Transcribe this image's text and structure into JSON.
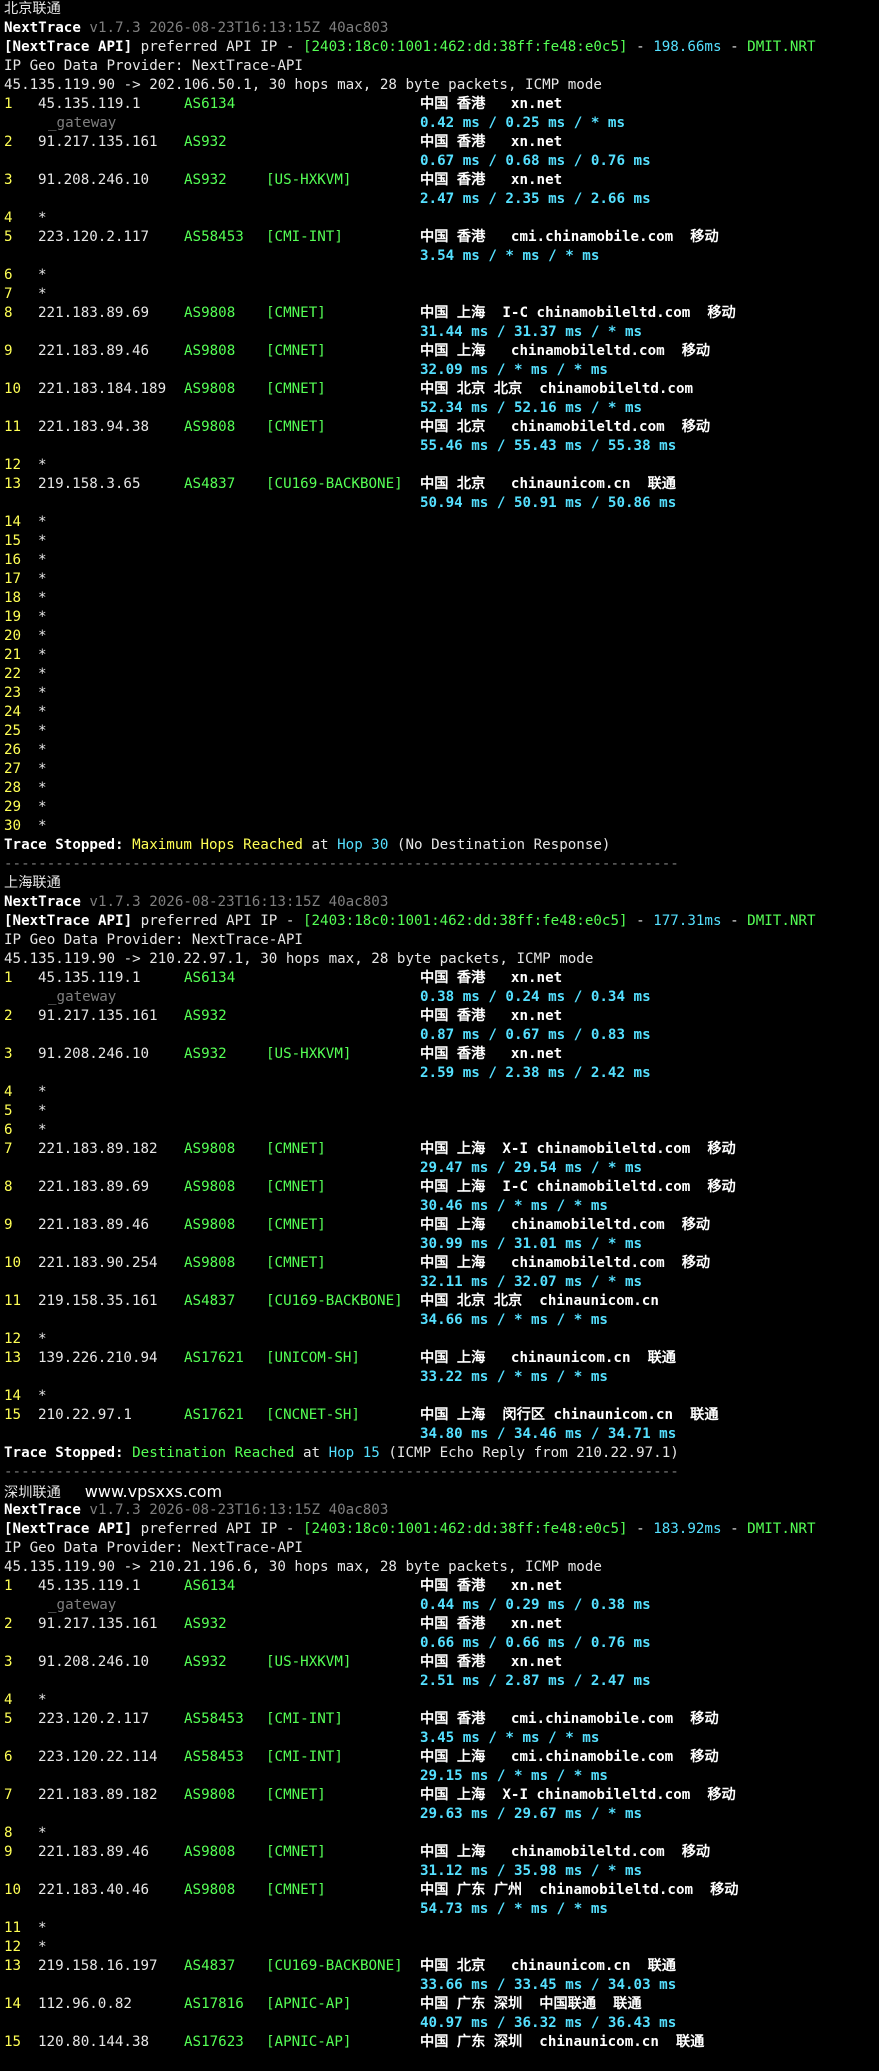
{
  "sections": [
    {
      "title": "北京联通",
      "tool": "NextTrace",
      "version": "v1.7.3 2026-08-23T16:13:15Z 40ac803",
      "api_line": {
        "tag": "[NextTrace API]",
        "text": " preferred API IP - ",
        "ip": "[2403:18c0:1001:462:dd:38ff:fe48:e0c5]",
        "sep": " - ",
        "rtt": "198.66ms",
        "sep2": " - ",
        "node": "DMIT.NRT"
      },
      "provider": "IP Geo Data Provider: NextTrace-API",
      "route": "45.135.119.90 -> 202.106.50.1, 30 hops max, 28 byte packets, ICMP mode",
      "hops": [
        {
          "n": "1",
          "ip": "45.135.119.1",
          "as": "AS6134",
          "tag": "",
          "geo": "中国 香港   xn.net",
          "gw": "_gateway",
          "rtt": "0.42 ms / 0.25 ms / * ms"
        },
        {
          "n": "2",
          "ip": "91.217.135.161",
          "as": "AS932",
          "tag": "",
          "geo": "中国 香港   xn.net",
          "rtt": "0.67 ms / 0.68 ms / 0.76 ms"
        },
        {
          "n": "3",
          "ip": "91.208.246.10",
          "as": "AS932",
          "tag": "[US-HXKVM]",
          "geo": "中国 香港   xn.net",
          "rtt": "2.47 ms / 2.35 ms / 2.66 ms"
        },
        {
          "n": "4",
          "ip": "*"
        },
        {
          "n": "5",
          "ip": "223.120.2.117",
          "as": "AS58453",
          "tag": "[CMI-INT]",
          "geo": "中国 香港   cmi.chinamobile.com  移动",
          "rtt": "3.54 ms / * ms / * ms"
        },
        {
          "n": "6",
          "ip": "*"
        },
        {
          "n": "7",
          "ip": "*"
        },
        {
          "n": "8",
          "ip": "221.183.89.69",
          "as": "AS9808",
          "tag": "[CMNET]",
          "geo": "中国 上海  I-C chinamobileltd.com  移动",
          "rtt": "31.44 ms / 31.37 ms / * ms"
        },
        {
          "n": "9",
          "ip": "221.183.89.46",
          "as": "AS9808",
          "tag": "[CMNET]",
          "geo": "中国 上海   chinamobileltd.com  移动",
          "rtt": "32.09 ms / * ms / * ms"
        },
        {
          "n": "10",
          "ip": "221.183.184.189",
          "as": "AS9808",
          "tag": "[CMNET]",
          "geo": "中国 北京 北京  chinamobileltd.com",
          "rtt": "52.34 ms / 52.16 ms / * ms"
        },
        {
          "n": "11",
          "ip": "221.183.94.38",
          "as": "AS9808",
          "tag": "[CMNET]",
          "geo": "中国 北京   chinamobileltd.com  移动",
          "rtt": "55.46 ms / 55.43 ms / 55.38 ms"
        },
        {
          "n": "12",
          "ip": "*"
        },
        {
          "n": "13",
          "ip": "219.158.3.65",
          "as": "AS4837",
          "tag": "[CU169-BACKBONE]",
          "geo": "中国 北京   chinaunicom.cn  联通",
          "rtt": "50.94 ms / 50.91 ms / 50.86 ms"
        },
        {
          "n": "14",
          "ip": "*"
        },
        {
          "n": "15",
          "ip": "*"
        },
        {
          "n": "16",
          "ip": "*"
        },
        {
          "n": "17",
          "ip": "*"
        },
        {
          "n": "18",
          "ip": "*"
        },
        {
          "n": "19",
          "ip": "*"
        },
        {
          "n": "20",
          "ip": "*"
        },
        {
          "n": "21",
          "ip": "*"
        },
        {
          "n": "22",
          "ip": "*"
        },
        {
          "n": "23",
          "ip": "*"
        },
        {
          "n": "24",
          "ip": "*"
        },
        {
          "n": "25",
          "ip": "*"
        },
        {
          "n": "26",
          "ip": "*"
        },
        {
          "n": "27",
          "ip": "*"
        },
        {
          "n": "28",
          "ip": "*"
        },
        {
          "n": "29",
          "ip": "*"
        },
        {
          "n": "30",
          "ip": "*"
        }
      ],
      "stop": {
        "prefix": "Trace Stopped: ",
        "reason": "Maximum Hops Reached",
        "mid": " at ",
        "hop": "Hop 30",
        "suffix": " (No Destination Response)",
        "reason_color": "y"
      }
    },
    {
      "title": "上海联通",
      "tool": "NextTrace",
      "version": "v1.7.3 2026-08-23T16:13:15Z 40ac803",
      "api_line": {
        "tag": "[NextTrace API]",
        "text": " preferred API IP - ",
        "ip": "[2403:18c0:1001:462:dd:38ff:fe48:e0c5]",
        "sep": " - ",
        "rtt": "177.31ms",
        "sep2": " - ",
        "node": "DMIT.NRT"
      },
      "provider": "IP Geo Data Provider: NextTrace-API",
      "route": "45.135.119.90 -> 210.22.97.1, 30 hops max, 28 byte packets, ICMP mode",
      "hops": [
        {
          "n": "1",
          "ip": "45.135.119.1",
          "as": "AS6134",
          "tag": "",
          "geo": "中国 香港   xn.net",
          "gw": "_gateway",
          "rtt": "0.38 ms / 0.24 ms / 0.34 ms"
        },
        {
          "n": "2",
          "ip": "91.217.135.161",
          "as": "AS932",
          "tag": "",
          "geo": "中国 香港   xn.net",
          "rtt": "0.87 ms / 0.67 ms / 0.83 ms"
        },
        {
          "n": "3",
          "ip": "91.208.246.10",
          "as": "AS932",
          "tag": "[US-HXKVM]",
          "geo": "中国 香港   xn.net",
          "rtt": "2.59 ms / 2.38 ms / 2.42 ms"
        },
        {
          "n": "4",
          "ip": "*"
        },
        {
          "n": "5",
          "ip": "*"
        },
        {
          "n": "6",
          "ip": "*"
        },
        {
          "n": "7",
          "ip": "221.183.89.182",
          "as": "AS9808",
          "tag": "[CMNET]",
          "geo": "中国 上海  X-I chinamobileltd.com  移动",
          "rtt": "29.47 ms / 29.54 ms / * ms"
        },
        {
          "n": "8",
          "ip": "221.183.89.69",
          "as": "AS9808",
          "tag": "[CMNET]",
          "geo": "中国 上海  I-C chinamobileltd.com  移动",
          "rtt": "30.46 ms / * ms / * ms"
        },
        {
          "n": "9",
          "ip": "221.183.89.46",
          "as": "AS9808",
          "tag": "[CMNET]",
          "geo": "中国 上海   chinamobileltd.com  移动",
          "rtt": "30.99 ms / 31.01 ms / * ms"
        },
        {
          "n": "10",
          "ip": "221.183.90.254",
          "as": "AS9808",
          "tag": "[CMNET]",
          "geo": "中国 上海   chinamobileltd.com  移动",
          "rtt": "32.11 ms / 32.07 ms / * ms"
        },
        {
          "n": "11",
          "ip": "219.158.35.161",
          "as": "AS4837",
          "tag": "[CU169-BACKBONE]",
          "geo": "中国 北京 北京  chinaunicom.cn",
          "rtt": "34.66 ms / * ms / * ms"
        },
        {
          "n": "12",
          "ip": "*"
        },
        {
          "n": "13",
          "ip": "139.226.210.94",
          "as": "AS17621",
          "tag": "[UNICOM-SH]",
          "geo": "中国 上海   chinaunicom.cn  联通",
          "rtt": "33.22 ms / * ms / * ms"
        },
        {
          "n": "14",
          "ip": "*"
        },
        {
          "n": "15",
          "ip": "210.22.97.1",
          "as": "AS17621",
          "tag": "[CNCNET-SH]",
          "geo": "中国 上海  闵行区 chinaunicom.cn  联通",
          "rtt": "34.80 ms / 34.46 ms / 34.71 ms"
        }
      ],
      "stop": {
        "prefix": "Trace Stopped: ",
        "reason": "Destination Reached",
        "mid": " at ",
        "hop": "Hop 15",
        "suffix": " (ICMP Echo Reply from 210.22.97.1)",
        "reason_color": "gr"
      }
    },
    {
      "title": "深圳联通",
      "site": "www.vpsxxs.com",
      "tool": "NextTrace",
      "version": "v1.7.3 2026-08-23T16:13:15Z 40ac803",
      "api_line": {
        "tag": "[NextTrace API]",
        "text": " preferred API IP - ",
        "ip": "[2403:18c0:1001:462:dd:38ff:fe48:e0c5]",
        "sep": " - ",
        "rtt": "183.92ms",
        "sep2": " - ",
        "node": "DMIT.NRT"
      },
      "provider": "IP Geo Data Provider: NextTrace-API",
      "route": "45.135.119.90 -> 210.21.196.6, 30 hops max, 28 byte packets, ICMP mode",
      "hops": [
        {
          "n": "1",
          "ip": "45.135.119.1",
          "as": "AS6134",
          "tag": "",
          "geo": "中国 香港   xn.net",
          "gw": "_gateway",
          "rtt": "0.44 ms / 0.29 ms / 0.38 ms"
        },
        {
          "n": "2",
          "ip": "91.217.135.161",
          "as": "AS932",
          "tag": "",
          "geo": "中国 香港   xn.net",
          "rtt": "0.66 ms / 0.66 ms / 0.76 ms"
        },
        {
          "n": "3",
          "ip": "91.208.246.10",
          "as": "AS932",
          "tag": "[US-HXKVM]",
          "geo": "中国 香港   xn.net",
          "rtt": "2.51 ms / 2.87 ms / 2.47 ms"
        },
        {
          "n": "4",
          "ip": "*"
        },
        {
          "n": "5",
          "ip": "223.120.2.117",
          "as": "AS58453",
          "tag": "[CMI-INT]",
          "geo": "中国 香港   cmi.chinamobile.com  移动",
          "rtt": "3.45 ms / * ms / * ms"
        },
        {
          "n": "6",
          "ip": "223.120.22.114",
          "as": "AS58453",
          "tag": "[CMI-INT]",
          "geo": "中国 上海   cmi.chinamobile.com  移动",
          "rtt": "29.15 ms / * ms / * ms"
        },
        {
          "n": "7",
          "ip": "221.183.89.182",
          "as": "AS9808",
          "tag": "[CMNET]",
          "geo": "中国 上海  X-I chinamobileltd.com  移动",
          "rtt": "29.63 ms / 29.67 ms / * ms"
        },
        {
          "n": "8",
          "ip": "*"
        },
        {
          "n": "9",
          "ip": "221.183.89.46",
          "as": "AS9808",
          "tag": "[CMNET]",
          "geo": "中国 上海   chinamobileltd.com  移动",
          "rtt": "31.12 ms / 35.98 ms / * ms"
        },
        {
          "n": "10",
          "ip": "221.183.40.46",
          "as": "AS9808",
          "tag": "[CMNET]",
          "geo": "中国 广东 广州  chinamobileltd.com  移动",
          "rtt": "54.73 ms / * ms / * ms"
        },
        {
          "n": "11",
          "ip": "*"
        },
        {
          "n": "12",
          "ip": "*"
        },
        {
          "n": "13",
          "ip": "219.158.16.197",
          "as": "AS4837",
          "tag": "[CU169-BACKBONE]",
          "geo": "中国 北京   chinaunicom.cn  联通",
          "rtt": "33.66 ms / 33.45 ms / 34.03 ms"
        },
        {
          "n": "14",
          "ip": "112.96.0.82",
          "as": "AS17816",
          "tag": "[APNIC-AP]",
          "geo": "中国 广东 深圳  中国联通  联通",
          "rtt": "40.97 ms / 36.32 ms / 36.43 ms"
        },
        {
          "n": "15",
          "ip": "120.80.144.38",
          "as": "AS17623",
          "tag": "[APNIC-AP]",
          "geo": "中国 广东 深圳  chinaunicom.cn  联通",
          "rtt": ""
        }
      ]
    }
  ],
  "divider": "-------------------------------------------------------------------------------"
}
